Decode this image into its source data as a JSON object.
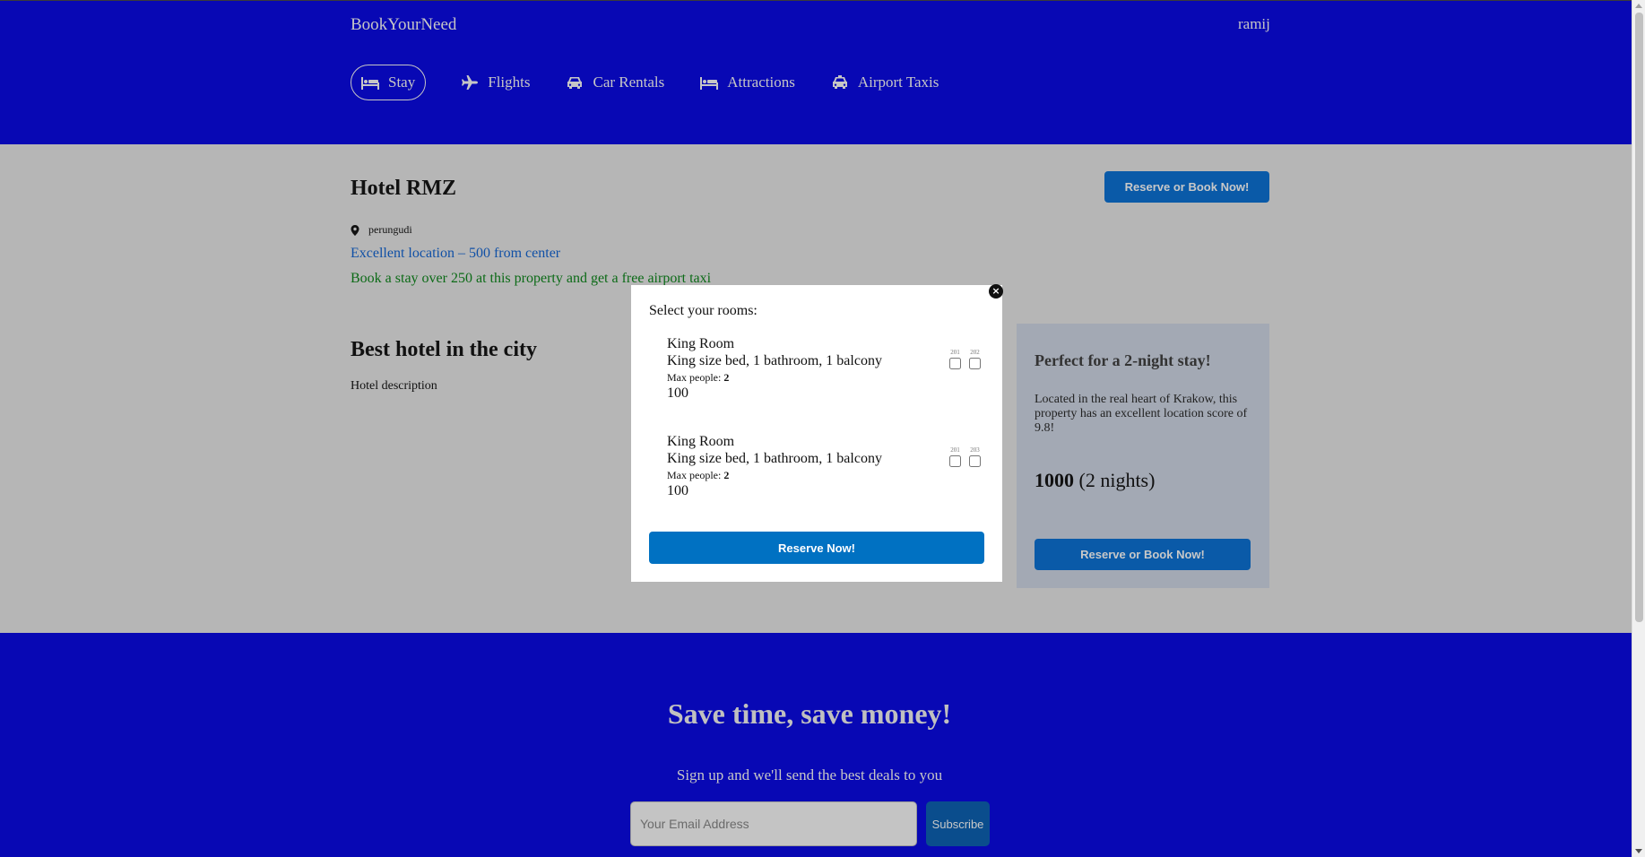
{
  "header": {
    "brand": "BookYourNeed",
    "user": "ramij",
    "nav": [
      {
        "label": "Stay",
        "icon": "bed-icon"
      },
      {
        "label": "Flights",
        "icon": "plane-icon"
      },
      {
        "label": "Car Rentals",
        "icon": "car-icon"
      },
      {
        "label": "Attractions",
        "icon": "bed-icon"
      },
      {
        "label": "Airport Taxis",
        "icon": "taxi-icon"
      }
    ]
  },
  "hotel": {
    "name": "Hotel RMZ",
    "book_label": "Reserve or Book Now!",
    "location": "perungudi",
    "distance": "Excellent location – 500 from center",
    "taxi_offer": "Book a stay over 250 at this property and get a free airport taxi",
    "desc_title": "Best hotel in the city",
    "desc_text": "Hotel description"
  },
  "sidebox": {
    "title": "Perfect for a 2-night stay!",
    "text": "Located in the real heart of Krakow, this property has an excellent location score of 9.8!",
    "price": "1000",
    "nights": "(2 nights)",
    "book_label": "Reserve or Book Now!"
  },
  "modal": {
    "title": "Select your rooms:",
    "close": "×",
    "max_label": "Max people:",
    "rooms": [
      {
        "title": "King Room",
        "desc": "King size bed, 1 bathroom, 1 balcony",
        "max": "2",
        "price": "100",
        "numbers": [
          "201",
          "202"
        ]
      },
      {
        "title": "King Room",
        "desc": "King size bed, 1 bathroom, 1 balcony",
        "max": "2",
        "price": "100",
        "numbers": [
          "201",
          "203"
        ]
      }
    ],
    "reserve_label": "Reserve Now!"
  },
  "signup": {
    "title": "Save time, save money!",
    "subtitle": "Sign up and we'll send the best deals to you",
    "placeholder": "Your Email Address",
    "button": "Subscribe"
  },
  "colors": {
    "header_bg": "#0808b4",
    "button_blue": "#0071c2",
    "taxi_green": "#0b6a16"
  }
}
